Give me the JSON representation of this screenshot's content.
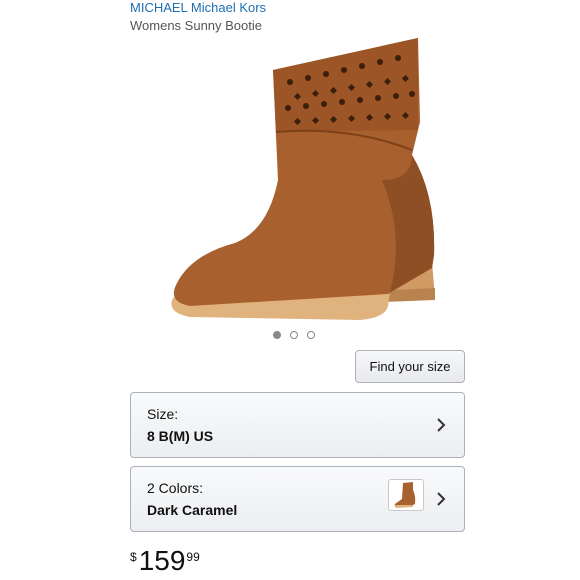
{
  "product": {
    "brand": "MICHAEL Michael Kors",
    "name": "Womens Sunny Bootie"
  },
  "gallery": {
    "image_count": 3,
    "active_index": 0,
    "image_icon": "boot-image"
  },
  "find_size_label": "Find your size",
  "size_selector": {
    "label": "Size:",
    "value": "8 B(M) US"
  },
  "color_selector": {
    "label": "2 Colors:",
    "value": "Dark Caramel",
    "swatch_icon": "boot-swatch"
  },
  "price": {
    "currency": "$",
    "whole": "159",
    "fraction": "99"
  },
  "colors": {
    "brand_link": "#1f6fb2",
    "suede": "#a8602e"
  }
}
